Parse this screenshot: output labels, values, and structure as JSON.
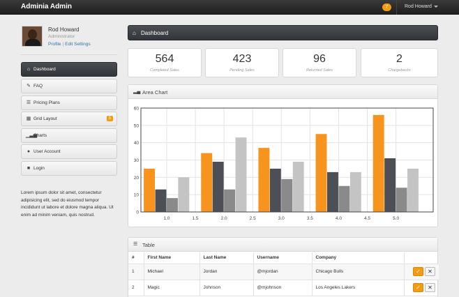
{
  "app": {
    "title": "Adminia Admin",
    "notification_count": "7",
    "user_menu": "Rod Howard"
  },
  "profile": {
    "name": "Rod Howard",
    "role": "Administrator",
    "profile_link": "Profile",
    "link_sep": "|",
    "settings_link": "Edit Settings"
  },
  "sidebar": {
    "items": [
      {
        "label": "Dashboard",
        "icon": "home-icon",
        "active": true
      },
      {
        "label": "FAQ",
        "icon": "pushpin-icon"
      },
      {
        "label": "Pricing Plans",
        "icon": "list-icon"
      },
      {
        "label": "Grid Layout",
        "icon": "grid-icon",
        "badge": "5"
      },
      {
        "label": "Charts",
        "icon": "signal-icon"
      },
      {
        "label": "User Account",
        "icon": "user-icon"
      },
      {
        "label": "Login",
        "icon": "lock-icon"
      }
    ],
    "text": "Lorem ipsum dolor sit amet, consectetur adipisicing elit, sed do eiusmod tempor incididunt ut labore et dolore magna aliqua. Ut enim ad minim veniam, quis nostrud."
  },
  "header": {
    "title": "Dashboard"
  },
  "stats": [
    {
      "value": "564",
      "label": "Completed Sales"
    },
    {
      "value": "423",
      "label": "Pending Sales"
    },
    {
      "value": "96",
      "label": "Returned Sales"
    },
    {
      "value": "2",
      "label": "Chargebacks"
    }
  ],
  "area_chart": {
    "title": "Area Chart"
  },
  "chart_data": {
    "type": "bar",
    "title": "",
    "categories": [
      "1",
      "2",
      "3",
      "4",
      "5"
    ],
    "x_tick_labels": [
      "1.0",
      "1.5",
      "2.0",
      "2.5",
      "3.0",
      "3.5",
      "4.0",
      "4.5",
      "5.0"
    ],
    "y_ticks": [
      "0",
      "10",
      "20",
      "30",
      "40",
      "50",
      "60"
    ],
    "ylim": [
      0,
      60
    ],
    "grid": true,
    "series": [
      {
        "values": [
          25,
          34,
          37,
          45,
          56
        ],
        "color": "#f7941d"
      },
      {
        "values": [
          13,
          29,
          25,
          23,
          31
        ],
        "color": "#4c4f55"
      },
      {
        "values": [
          8,
          13,
          19,
          15,
          14
        ],
        "color": "#8a8a8a"
      },
      {
        "values": [
          20,
          43,
          29,
          23,
          25
        ],
        "color": "#c4c4c4"
      }
    ]
  },
  "table": {
    "title": "Table",
    "columns": [
      "#",
      "First Name",
      "Last Name",
      "Username",
      "Company",
      ""
    ],
    "rows": [
      [
        "1",
        "Michael",
        "Jordan",
        "@mjordan",
        "Chicago Bulls"
      ],
      [
        "2",
        "Magic",
        "Johnson",
        "@mjohnson",
        "Los Angeles Lakers"
      ]
    ]
  }
}
